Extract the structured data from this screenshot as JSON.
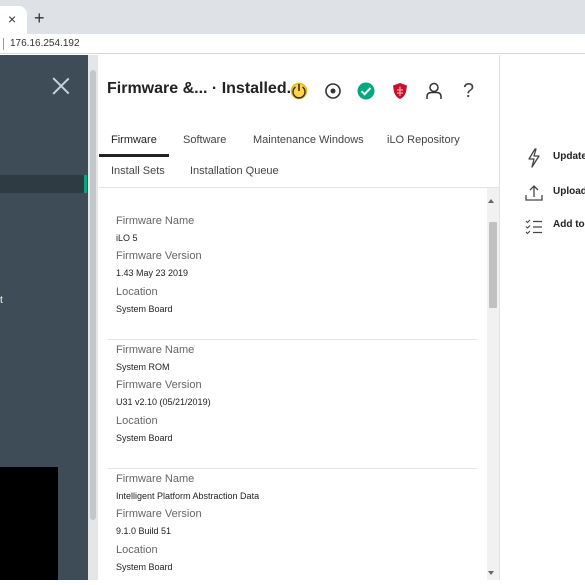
{
  "browser": {
    "tab_close": "×",
    "new_tab": "+",
    "address": "176.16.254.192"
  },
  "left_nav": {
    "visible_fragment": "t"
  },
  "header": {
    "title": "Firmware &... · Installed...",
    "icons": [
      "power-icon",
      "uid-target-icon",
      "health-ok-icon",
      "security-shield-icon",
      "user-icon",
      "help-icon"
    ],
    "help_glyph": "?"
  },
  "tabs": {
    "firmware": "Firmware",
    "software": "Software",
    "maintenance_windows": "Maintenance Windows",
    "ilo_repository": "iLO Repository",
    "install_sets": "Install Sets",
    "installation_queue": "Installation Queue"
  },
  "firmware_items": [
    {
      "name_label": "Firmware Name",
      "name": "iLO 5",
      "version_label": "Firmware Version",
      "version": "1.43 May 23 2019",
      "location_label": "Location",
      "location": "System Board"
    },
    {
      "name_label": "Firmware Name",
      "name": "System ROM",
      "version_label": "Firmware Version",
      "version": "U31 v2.10 (05/21/2019)",
      "location_label": "Location",
      "location": "System Board"
    },
    {
      "name_label": "Firmware Name",
      "name": "Intelligent Platform Abstraction Data",
      "version_label": "Firmware Version",
      "version": "9.1.0 Build 51",
      "location_label": "Location",
      "location": "System Board"
    }
  ],
  "actions": {
    "update": "Update",
    "upload": "Upload",
    "add_to": "Add to"
  },
  "colors": {
    "nav_bg": "#3d4c56",
    "accent_green": "#01a982",
    "power_yellow": "#f5b800",
    "security_red": "#c8102e"
  }
}
